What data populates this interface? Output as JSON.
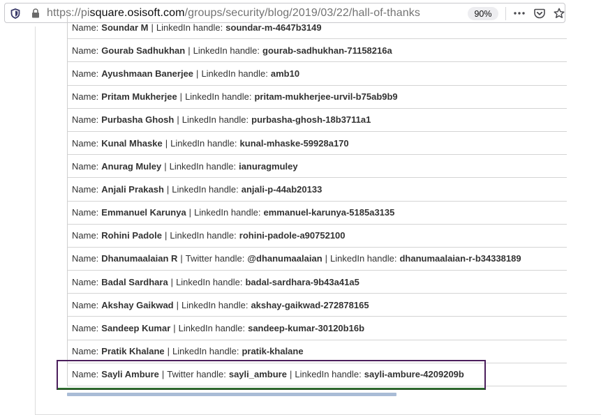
{
  "browser": {
    "url_prefix": "https://pi",
    "url_host": "square.osisoft.com",
    "url_path": "/groups/security/blog/2019/03/22/hall-of-thanks",
    "zoom": "90%",
    "icons": [
      "shield-icon",
      "lock-icon",
      "more-icon",
      "pocket-icon",
      "star-icon"
    ]
  },
  "labels": {
    "name": "Name:",
    "linkedin": "LinkedIn handle:",
    "twitter": "Twitter handle:",
    "pipe": "|"
  },
  "rows": [
    {
      "name": "Soundar M",
      "linkedin": "soundar-m-4647b3149"
    },
    {
      "name": "Gourab Sadhukhan",
      "linkedin": "gourab-sadhukhan-71158216a"
    },
    {
      "name": "Ayushmaan Banerjee",
      "linkedin": "amb10"
    },
    {
      "name": "Pritam Mukherjee",
      "linkedin": "pritam-mukherjee-urvil-b75ab9b9"
    },
    {
      "name": "Purbasha Ghosh",
      "linkedin": "purbasha-ghosh-18b3711a1"
    },
    {
      "name": "Kunal Mhaske",
      "linkedin": "kunal-mhaske-59928a170"
    },
    {
      "name": "Anurag Muley",
      "linkedin": "ianuragmuley"
    },
    {
      "name": "Anjali Prakash",
      "linkedin": "anjali-p-44ab20133"
    },
    {
      "name": "Emmanuel Karunya",
      "linkedin": "emmanuel-karunya-5185a3135"
    },
    {
      "name": "Rohini Padole",
      "linkedin": "rohini-padole-a90752100"
    },
    {
      "name": "Dhanumaalaian R",
      "twitter": "@dhanumaalaian",
      "linkedin": "dhanumaalaian-r-b34338189"
    },
    {
      "name": "Badal Sardhara",
      "linkedin": "badal-sardhara-9b43a41a5"
    },
    {
      "name": "Akshay Gaikwad",
      "linkedin": "akshay-gaikwad-272878165"
    },
    {
      "name": "Sandeep Kumar",
      "linkedin": "sandeep-kumar-30120b16b"
    },
    {
      "name": "Pratik Khalane",
      "linkedin": "pratik-khalane"
    },
    {
      "name": "Sayli Ambure",
      "twitter": "sayli_ambure",
      "linkedin": "sayli-ambure-4209209b"
    }
  ]
}
